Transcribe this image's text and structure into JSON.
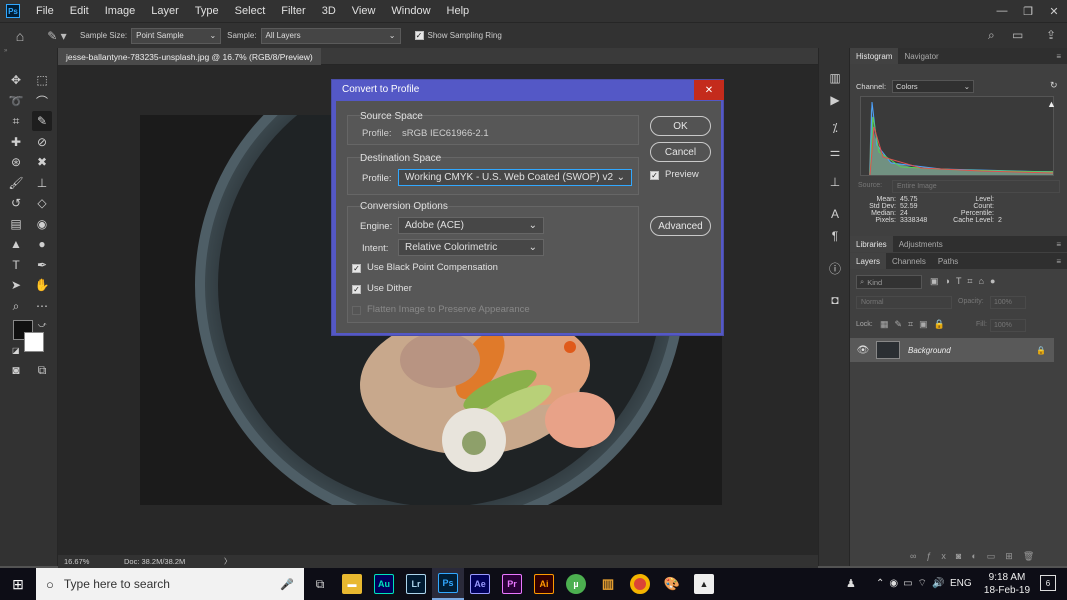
{
  "menu": {
    "app_logo": "Ps",
    "items": [
      "File",
      "Edit",
      "Image",
      "Layer",
      "Type",
      "Select",
      "Filter",
      "3D",
      "View",
      "Window",
      "Help"
    ],
    "controls": {
      "minimize": "—",
      "restore": "❐",
      "close": "✕"
    }
  },
  "options_bar": {
    "sample_size_label": "Sample Size:",
    "sample_size_value": "Point Sample",
    "sample_label": "Sample:",
    "sample_value": "All Layers",
    "show_sampling_ring_label": "Show Sampling Ring",
    "show_sampling_ring_checked": true
  },
  "document": {
    "tab_title": "jesse-ballantyne-783235-unsplash.jpg @ 16.7% (RGB/8/Preview)",
    "zoom": "16.67%",
    "doc_info": "Doc: 38.2M/38.2M",
    "status_arrow": "〉"
  },
  "dialog": {
    "title": "Convert to Profile",
    "close": "✕",
    "source_space": {
      "heading": "Source Space",
      "profile_label": "Profile:",
      "profile_value": "sRGB IEC61966-2.1"
    },
    "destination_space": {
      "heading": "Destination Space",
      "profile_label": "Profile:",
      "profile_value": "Working CMYK - U.S. Web Coated (SWOP) v2"
    },
    "conversion_options": {
      "heading": "Conversion Options",
      "engine_label": "Engine:",
      "engine_value": "Adobe (ACE)",
      "intent_label": "Intent:",
      "intent_value": "Relative Colorimetric",
      "black_point_label": "Use Black Point Compensation",
      "black_point_checked": true,
      "dither_label": "Use Dither",
      "dither_checked": true,
      "flatten_label": "Flatten Image to Preserve Appearance",
      "flatten_checked": false
    },
    "ok_label": "OK",
    "cancel_label": "Cancel",
    "preview_label": "Preview",
    "preview_checked": true,
    "advanced_label": "Advanced"
  },
  "histogram_panel": {
    "tabs": [
      "Histogram",
      "Navigator"
    ],
    "channel_label": "Channel:",
    "channel_value": "Colors",
    "source_label": "Source:",
    "source_value": "Entire Image",
    "stats_left": [
      {
        "label": "Mean:",
        "value": "45.75"
      },
      {
        "label": "Std Dev:",
        "value": "52.59"
      },
      {
        "label": "Median:",
        "value": "24"
      },
      {
        "label": "Pixels:",
        "value": "3338348"
      }
    ],
    "stats_right": [
      {
        "label": "Level:",
        "value": ""
      },
      {
        "label": "Count:",
        "value": ""
      },
      {
        "label": "Percentile:",
        "value": ""
      },
      {
        "label": "Cache Level:",
        "value": "2"
      }
    ]
  },
  "libraries_tabs": [
    "Libraries",
    "Adjustments"
  ],
  "layers_panel": {
    "tabs": [
      "Layers",
      "Channels",
      "Paths"
    ],
    "filter_value": "Kind",
    "blend_mode": "Normal",
    "opacity_label": "Opacity:",
    "opacity_value": "100%",
    "lock_label": "Lock:",
    "fill_label": "Fill:",
    "fill_value": "100%",
    "layer_name": "Background"
  },
  "taskbar": {
    "search_placeholder": "Type here to search",
    "apps": [
      {
        "name": "Au",
        "color": "#00e4bb",
        "bg": "#00005b"
      },
      {
        "name": "Lr",
        "color": "#add5ec",
        "bg": "#001a31"
      },
      {
        "name": "Ps",
        "color": "#31a8ff",
        "bg": "#001e36"
      },
      {
        "name": "Ae",
        "color": "#9999ff",
        "bg": "#00005b"
      },
      {
        "name": "Pr",
        "color": "#ea77ff",
        "bg": "#2a0038"
      },
      {
        "name": "Ai",
        "color": "#ff9a00",
        "bg": "#330000"
      }
    ],
    "language": "ENG",
    "time": "9:18 AM",
    "date": "18-Feb-19",
    "notifications": "6"
  },
  "colors": {
    "dialog_title_bg": "#5458c6",
    "dialog_close_bg": "#c42b1c",
    "panel_bg": "#535353",
    "ps_blue": "#31a8ff"
  }
}
